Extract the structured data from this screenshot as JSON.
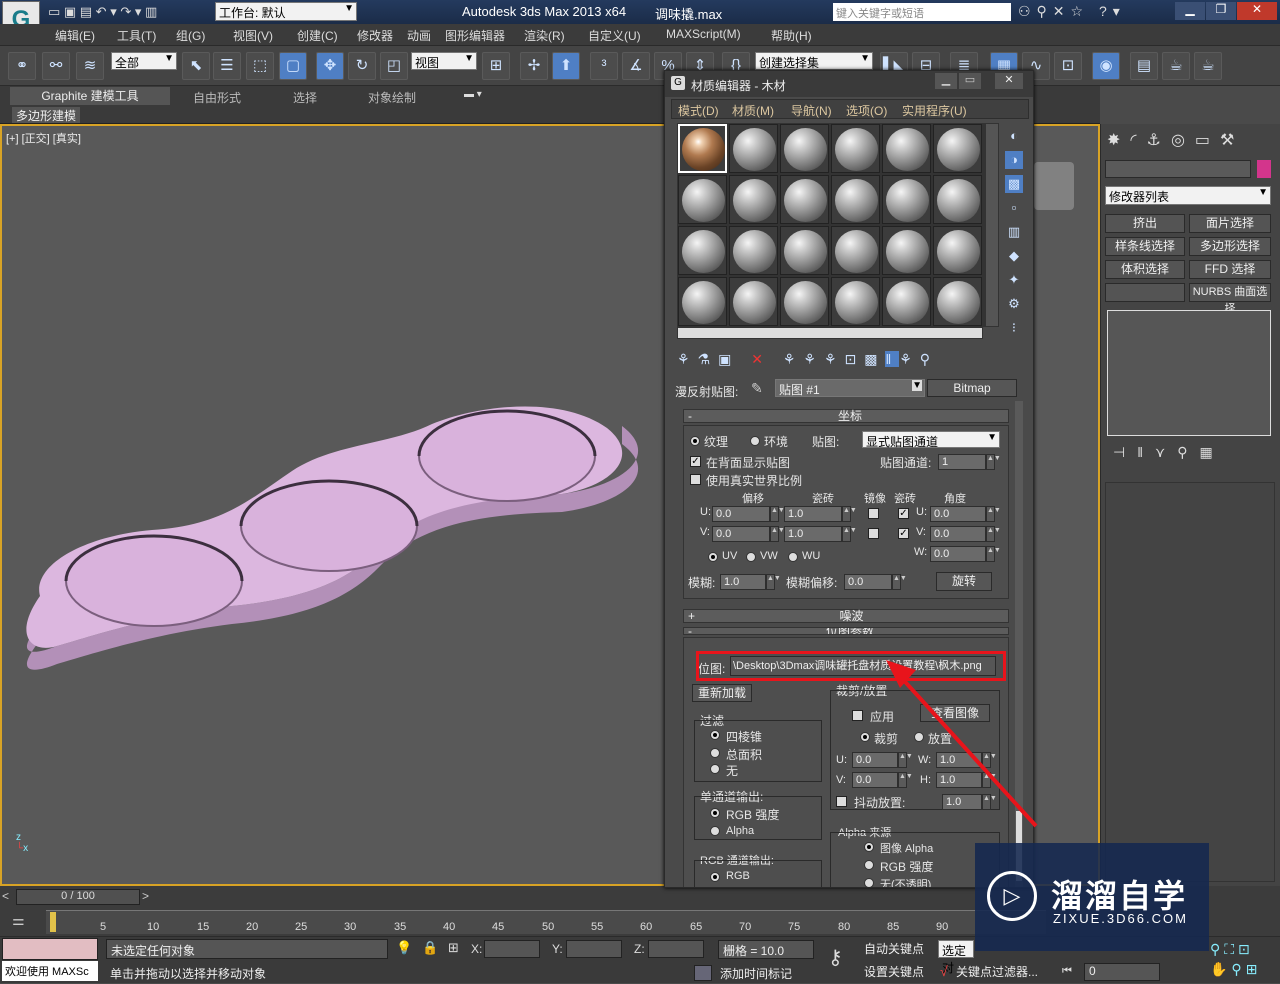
{
  "titlebar": {
    "workspace_label": "工作台: 默认",
    "app_title": "Autodesk 3ds Max  2013 x64",
    "file_name": "调味撬.max",
    "search_placeholder": "键入关键字或短语"
  },
  "menu": [
    "编辑(E)",
    "工具(T)",
    "组(G)",
    "视图(V)",
    "创建(C)",
    "修改器",
    "动画",
    "图形编辑器",
    "渲染(R)",
    "自定义(U)",
    "MAXScript(M)",
    "帮助(H)"
  ],
  "toolbar": {
    "filter": "全部",
    "ref_coord": "视图",
    "selection_set": "创建选择集"
  },
  "ribbon": {
    "tabs": [
      "Graphite 建模工具",
      "自由形式",
      "选择",
      "对象绘制"
    ],
    "subtab": "多边形建模"
  },
  "viewport": {
    "label": "[+] [正交] [真实]"
  },
  "material_editor": {
    "title": "材质编辑器 - 木材",
    "menu": [
      "模式(D)",
      "材质(M)",
      "导航(N)",
      "选项(O)",
      "实用程序(U)"
    ],
    "map_label": "漫反射贴图:",
    "map_name": "贴图 #1",
    "map_type": "Bitmap",
    "coords": {
      "header": "坐标",
      "texture": "纹理",
      "environ": "环境",
      "mapping_label": "贴图:",
      "mapping": "显式贴图通道",
      "show_back": "在背面显示贴图",
      "map_channel_label": "贴图通道:",
      "map_channel": "1",
      "real_world": "使用真实世界比例",
      "col_offset": "偏移",
      "col_tiling": "瓷砖",
      "col_mirror": "镜像",
      "col_tile": "瓷砖",
      "col_angle": "角度",
      "u_label": "U:",
      "v_label": "V:",
      "w_label": "W:",
      "u_offset": "0.0",
      "v_offset": "0.0",
      "u_tiling": "1.0",
      "v_tiling": "1.0",
      "u_angle": "0.0",
      "v_angle": "0.0",
      "w_angle": "0.0",
      "uv": "UV",
      "vw": "VW",
      "wu": "WU",
      "blur_label": "模糊:",
      "blur": "1.0",
      "blur_offset_label": "模糊偏移:",
      "blur_offset": "0.0",
      "rotate": "旋转"
    },
    "noise_header": "噪波",
    "bitmap_params": {
      "header": "位图参数",
      "bitmap_label": "位图:",
      "path": "\\Desktop\\3Dmax调味罐托盘材质设置教程\\枫木.png",
      "reload": "重新加载",
      "crop_group": "裁剪/放置",
      "apply": "应用",
      "view_image": "查看图像",
      "crop": "裁剪",
      "place": "放置",
      "u": "0.0",
      "v": "0.0",
      "w": "1.0",
      "h": "1.0",
      "h_label": "H:",
      "jitter_label": "抖动放置:",
      "jitter": "1.0",
      "filter_group": "过滤",
      "pyramidal": "四棱锥",
      "summed": "总面积",
      "none": "无",
      "mono_group": "单通道输出:",
      "rgb_intensity": "RGB 强度",
      "alpha": "Alpha",
      "alpha_source_group": "Alpha 来源",
      "image_alpha": "图像 Alpha",
      "alpha_rgb": "RGB 强度",
      "opaque": "无(不透明)",
      "rgb_group": "RGB 通道输出:",
      "rgb": "RGB"
    }
  },
  "command_panel": {
    "modifier_list": "修改器列表",
    "buttons": [
      "挤出",
      "面片选择",
      "样条线选择",
      "多边形选择",
      "体积选择",
      "FFD 选择",
      "",
      "NURBS 曲面选择"
    ]
  },
  "timeline": {
    "frame": "0 / 100",
    "ticks": [
      "0",
      "5",
      "10",
      "15",
      "20",
      "25",
      "30",
      "35",
      "40",
      "45",
      "50",
      "55",
      "60",
      "65",
      "70",
      "75",
      "80",
      "85",
      "90"
    ]
  },
  "status": {
    "welcome": "欢迎使用 MAXSc",
    "selection": "未选定任何对象",
    "prompt": "单击并拖动以选择并移动对象",
    "x_label": "X:",
    "y_label": "Y:",
    "z_label": "Z:",
    "grid": "栅格 = 10.0",
    "add_time_tag": "添加时间标记",
    "auto_key": "自动关键点",
    "set_key": "设置关键点",
    "selected": "选定对",
    "key_filters": "关键点过滤器...",
    "frame_value": "0"
  },
  "watermark": {
    "brand": "溜溜自学",
    "url": "ZIXUE.3D66.COM"
  },
  "colors": {
    "highlight": "#e8141b",
    "object": "#dcb7df",
    "viewport_border": "#d8a325"
  }
}
